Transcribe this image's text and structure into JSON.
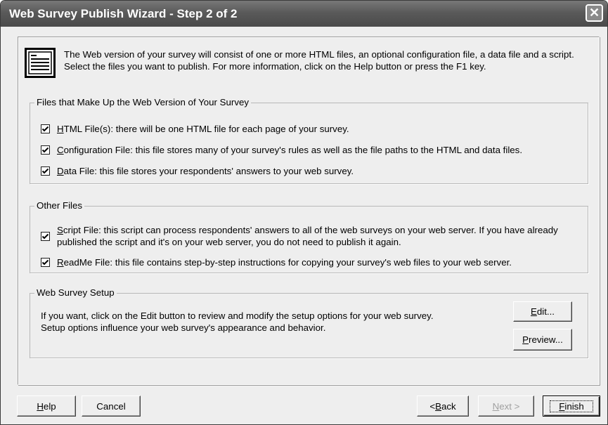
{
  "window": {
    "title": "Web Survey Publish Wizard - Step 2 of 2",
    "close_glyph": "✕"
  },
  "intro": {
    "icon": "document-list-icon",
    "text": "The Web version of your survey will consist of one or more HTML files, an optional configuration file, a data file and a script. Select the files you want to publish. For more information, click on the Help button or press the F1 key."
  },
  "files_group": {
    "legend": "Files that Make Up the Web Version of Your Survey",
    "items": [
      {
        "key": "H",
        "rest": "TML File(s): there will be one HTML file for each page of your survey.",
        "checked": true
      },
      {
        "key": "C",
        "rest": "onfiguration File: this file stores many of your survey's rules as well as the file paths to the HTML and data files.",
        "checked": true
      },
      {
        "key": "D",
        "rest": "ata File: this file stores your respondents' answers to your web survey.",
        "checked": true
      }
    ]
  },
  "other_group": {
    "legend": "Other Files",
    "items": [
      {
        "key": "S",
        "rest": "cript File: this script can process respondents' answers to all of the web surveys on your web server. If you have already published the script and it's on your web server, you do not need to publish it again.",
        "checked": true
      },
      {
        "key": "R",
        "rest": "eadMe File: this file contains step-by-step instructions for copying your survey's web files to your web server.",
        "checked": true
      }
    ]
  },
  "setup_group": {
    "legend": "Web Survey Setup",
    "line1": "If you want, click on the Edit button to review and modify the setup options for your web survey.",
    "line2": "Setup options influence your web survey's appearance and behavior.",
    "edit": {
      "key": "E",
      "rest": "dit..."
    },
    "preview": {
      "key": "P",
      "rest": "review..."
    }
  },
  "buttons": {
    "help": {
      "key": "H",
      "rest": "elp"
    },
    "cancel": "Cancel",
    "back": {
      "prefix": "< ",
      "key": "B",
      "rest": "ack"
    },
    "next": {
      "key": "N",
      "rest": "ext >",
      "enabled": false
    },
    "finish": {
      "key": "F",
      "rest": "inish",
      "default": true
    }
  }
}
